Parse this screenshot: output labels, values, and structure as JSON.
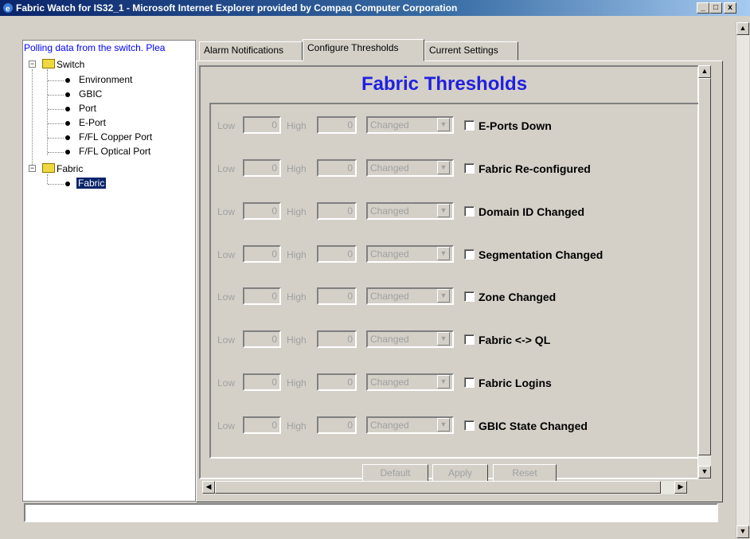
{
  "window": {
    "title": "Fabric Watch for IS32_1 - Microsoft Internet Explorer provided by Compaq Computer Corporation",
    "controls": {
      "minimize": "_",
      "maximize": "□",
      "close": "x"
    }
  },
  "tree": {
    "status_text": "Polling data from the switch.  Plea",
    "switch_label": "Switch",
    "switch_children": [
      "Environment",
      "GBIC",
      "Port",
      "E-Port",
      "F/FL Copper Port",
      "F/FL Optical Port"
    ],
    "fabric_label": "Fabric",
    "fabric_children": [
      "Fabric"
    ],
    "expander_symbol": "−"
  },
  "tabs": [
    {
      "label": "Alarm Notifications",
      "active": false
    },
    {
      "label": "Configure Thresholds",
      "active": true
    },
    {
      "label": "Current Settings",
      "active": false
    }
  ],
  "content": {
    "title": "Fabric Thresholds",
    "title_color": "#2020e0",
    "low_label": "Low",
    "high_label": "High",
    "rows": [
      {
        "low": "0",
        "high": "0",
        "condition": "Changed",
        "label": "E-Ports Down"
      },
      {
        "low": "0",
        "high": "0",
        "condition": "Changed",
        "label": "Fabric Re-configured"
      },
      {
        "low": "0",
        "high": "0",
        "condition": "Changed",
        "label": "Domain ID Changed"
      },
      {
        "low": "0",
        "high": "0",
        "condition": "Changed",
        "label": "Segmentation Changed"
      },
      {
        "low": "0",
        "high": "0",
        "condition": "Changed",
        "label": "Zone Changed"
      },
      {
        "low": "0",
        "high": "0",
        "condition": "Changed",
        "label": "Fabric <-> QL"
      },
      {
        "low": "0",
        "high": "0",
        "condition": "Changed",
        "label": "Fabric Logins"
      },
      {
        "low": "0",
        "high": "0",
        "condition": "Changed",
        "label": "GBIC State Changed"
      }
    ],
    "buttons": {
      "default": "Default",
      "apply": "Apply",
      "reset": "Reset"
    }
  },
  "scroll_glyphs": {
    "up": "▲",
    "down": "▼",
    "left": "◀",
    "right": "▶",
    "dropdown": "▼"
  }
}
